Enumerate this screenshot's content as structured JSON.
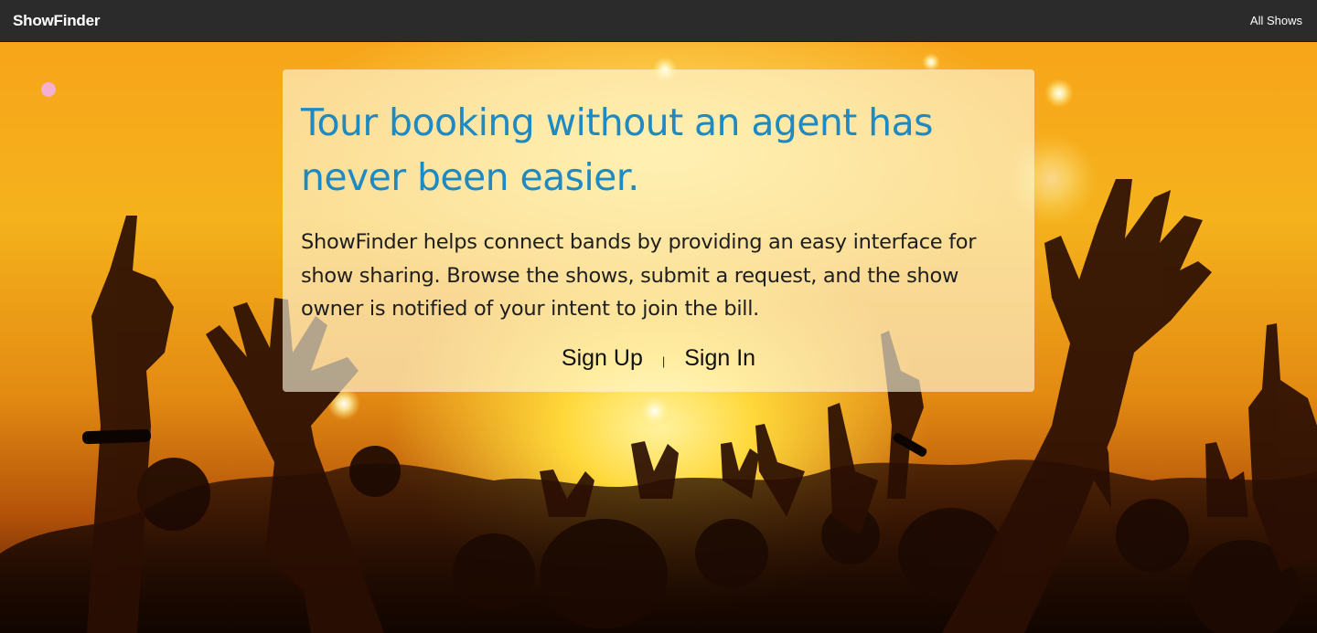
{
  "navbar": {
    "brand": "ShowFinder",
    "all_shows": "All Shows"
  },
  "hero": {
    "headline": "Tour booking without an agent has never been easier.",
    "description": "ShowFinder helps connect bands by providing an easy interface for show sharing. Browse the shows, submit a request, and the show owner is notified of your intent to join the bill.",
    "sign_up": "Sign Up",
    "separator": "|",
    "sign_in": "Sign In"
  },
  "background_image": {
    "subject": "concert crowd with raised hands, stage lights",
    "colors": [
      "#f7a51a",
      "#ffd83a",
      "#b3520a",
      "#1a0a02"
    ]
  }
}
